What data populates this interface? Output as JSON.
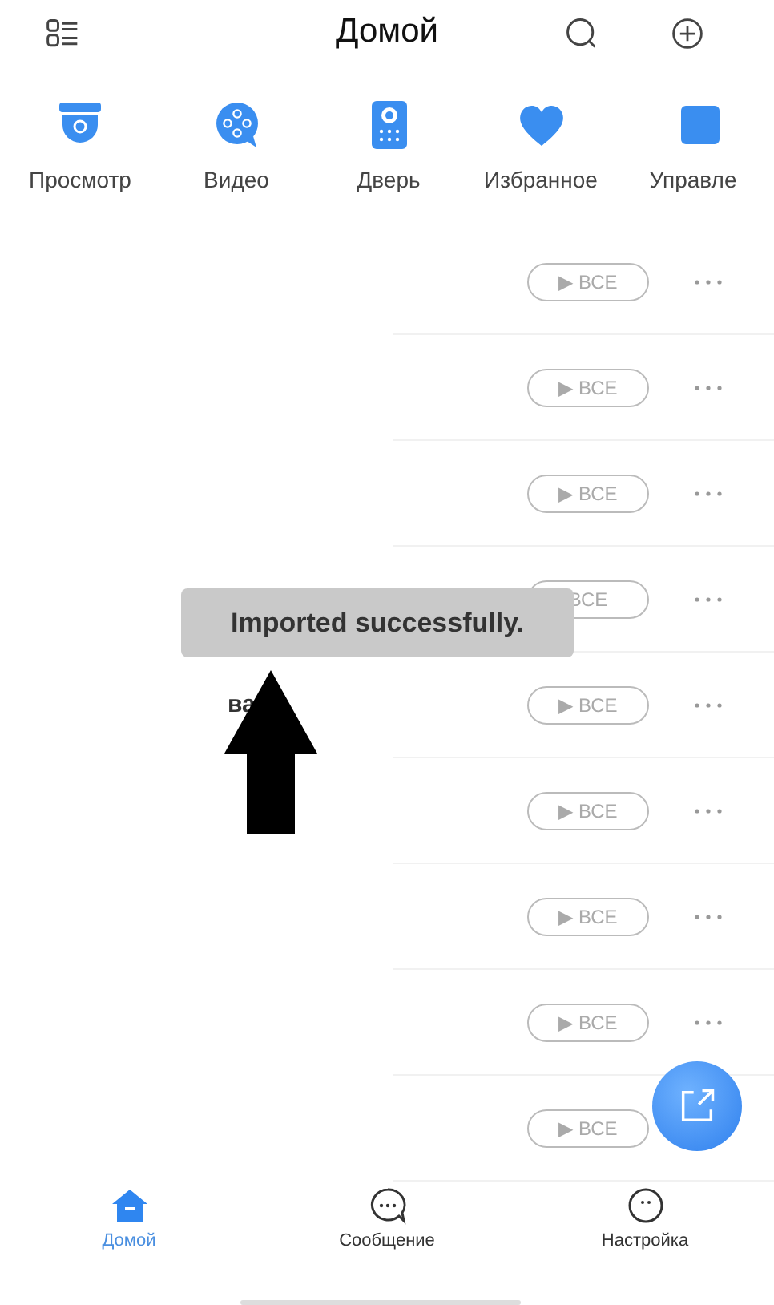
{
  "header": {
    "title": "Домой"
  },
  "quick_items": [
    {
      "label": "Просмотр"
    },
    {
      "label": "Видео"
    },
    {
      "label": "Дверь"
    },
    {
      "label": "Избранное"
    },
    {
      "label": "Управле"
    }
  ],
  "devices": [
    {
      "play": "▶ ВСЕ",
      "more_menu": true
    },
    {
      "play": "▶ ВСЕ",
      "more_menu": true
    },
    {
      "play": "▶ ВСЕ",
      "more_menu": true
    },
    {
      "play": "ВСЕ",
      "more_menu": true
    },
    {
      "name": "ва",
      "play": "▶ ВСЕ",
      "more_menu": true
    },
    {
      "play": "▶ ВСЕ",
      "more_menu": true
    },
    {
      "play": "▶ ВСЕ",
      "more_menu": true
    },
    {
      "play": "▶ ВСЕ",
      "more_menu": true
    },
    {
      "play": "▶ ВСЕ",
      "more_menu": false
    }
  ],
  "toast": "Imported successfully.",
  "tabs": [
    {
      "label": "Домой",
      "selected": true
    },
    {
      "label": "Сообщение",
      "selected": false
    },
    {
      "label": "Настройка",
      "selected": false
    }
  ]
}
